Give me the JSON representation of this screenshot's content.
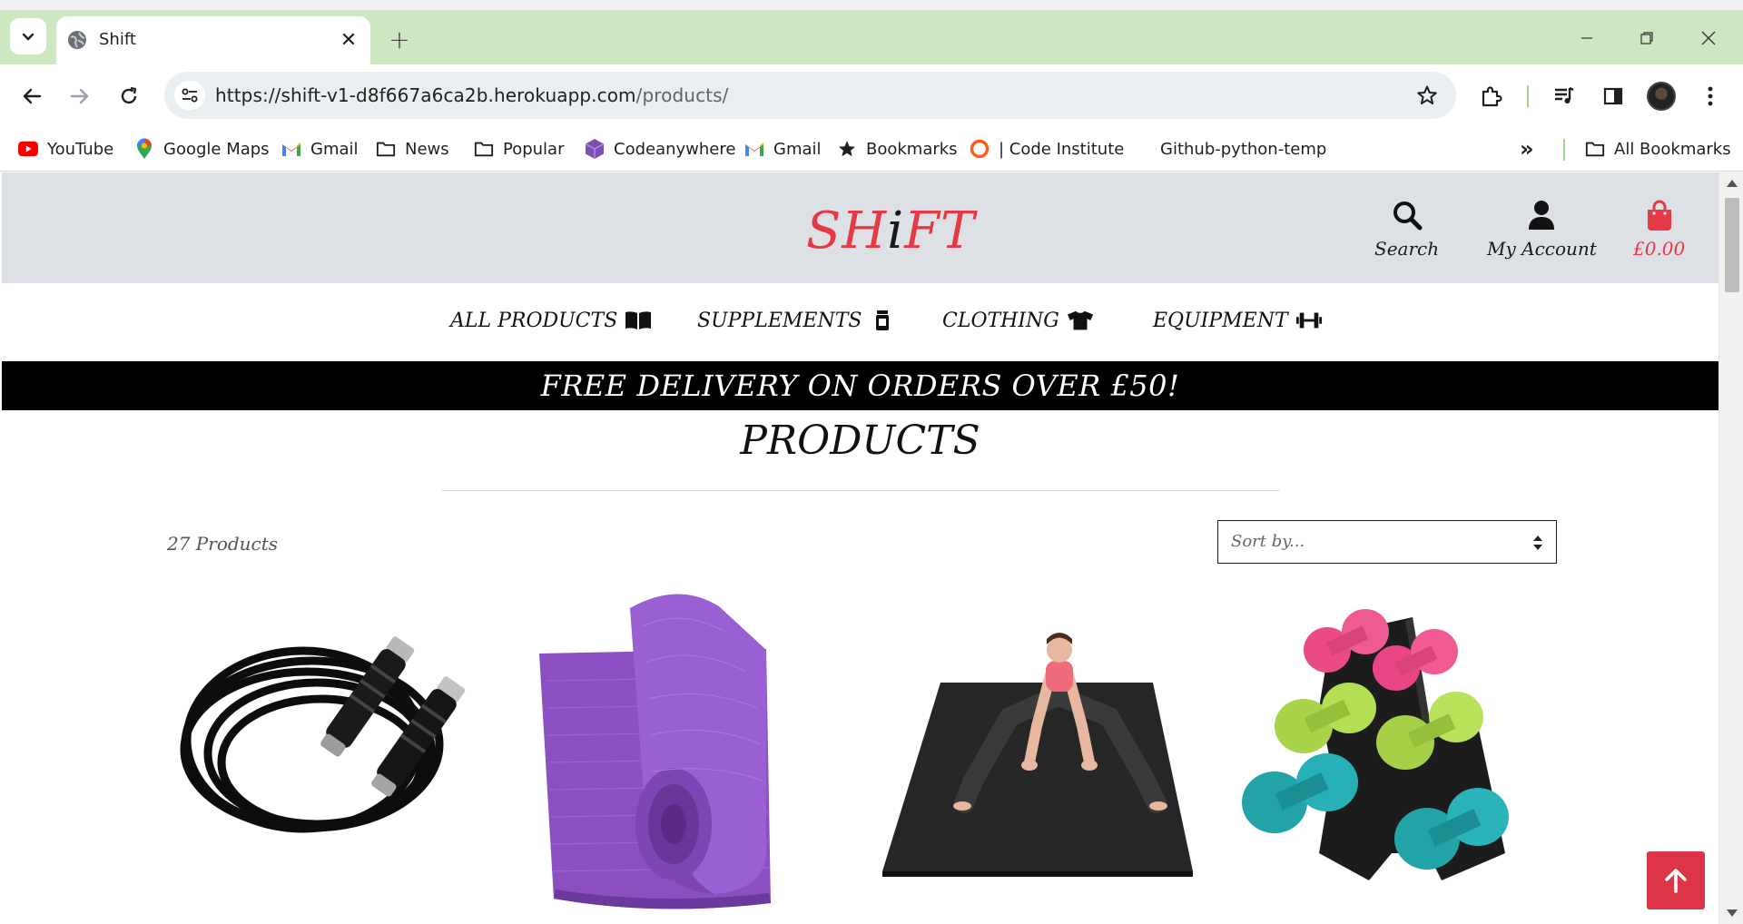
{
  "browser": {
    "tab_title": "Shift",
    "url_host": "https://shift-v1-d8f667a6ca2b.herokuapp.com",
    "url_path": "/products/",
    "bookmarks": [
      {
        "label": "YouTube",
        "icon": "youtube-icon"
      },
      {
        "label": "Google Maps",
        "icon": "maps-pin-icon"
      },
      {
        "label": "Gmail",
        "icon": "gmail-icon"
      },
      {
        "label": "News",
        "icon": "folder-icon"
      },
      {
        "label": "Popular",
        "icon": "folder-icon"
      },
      {
        "label": "Codeanywhere",
        "icon": "codeanywhere-icon"
      },
      {
        "label": "Gmail",
        "icon": "gmail-icon"
      },
      {
        "label": "Bookmarks",
        "icon": "star-icon"
      },
      {
        "label": "| Code Institute",
        "icon": "code-institute-icon"
      },
      {
        "label": "Github-python-temp",
        "icon": ""
      }
    ],
    "all_bookmarks_label": "All Bookmarks",
    "more_label": "»"
  },
  "site": {
    "logo_left": "SH",
    "logo_i": "i",
    "logo_right": "FT",
    "brand_color": "#e63946",
    "header": {
      "search_label": "Search",
      "account_label": "My Account",
      "bag_total": "£0.00"
    },
    "nav": [
      {
        "label": "ALL PRODUCTS",
        "icon": "book-open-icon"
      },
      {
        "label": "SUPPLEMENTS",
        "icon": "supplement-tub-icon"
      },
      {
        "label": "CLOTHING",
        "icon": "tshirt-icon"
      },
      {
        "label": "EQUIPMENT",
        "icon": "dumbbell-icon"
      }
    ],
    "banner": "FREE DELIVERY ON ORDERS OVER £50!",
    "page_title": "PRODUCTS",
    "product_count": "27 Products",
    "sort_placeholder": "Sort by...",
    "products": [
      {
        "image": "jump-rope-image"
      },
      {
        "image": "yoga-mat-image"
      },
      {
        "image": "exercise-mat-image"
      },
      {
        "image": "dumbbell-set-image"
      }
    ]
  }
}
